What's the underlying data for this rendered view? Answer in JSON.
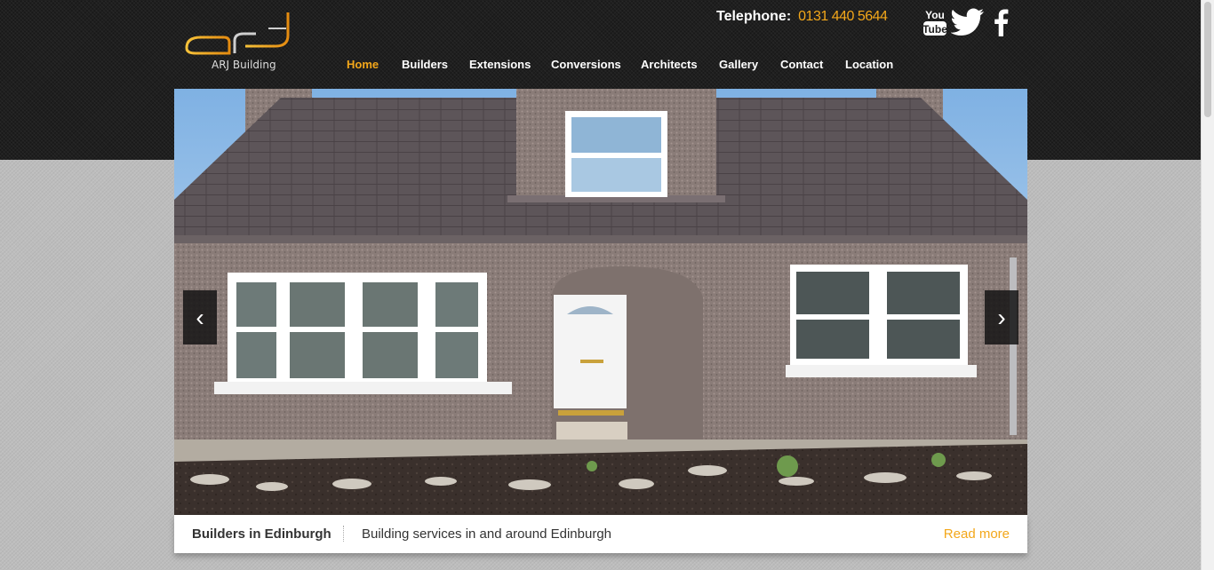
{
  "brand": {
    "name": "ARJ Building"
  },
  "header": {
    "telephone_label": "Telephone:",
    "telephone_number": "0131 440 5644"
  },
  "social": [
    {
      "icon": "youtube-icon",
      "label": "You Tube"
    },
    {
      "icon": "twitter-icon",
      "label": ""
    },
    {
      "icon": "facebook-icon",
      "label": "f"
    }
  ],
  "nav": {
    "items": [
      {
        "label": "Home",
        "active": true
      },
      {
        "label": "Builders"
      },
      {
        "label": "Extensions"
      },
      {
        "label": "Conversions"
      },
      {
        "label": "Architects"
      },
      {
        "label": "Gallery"
      },
      {
        "label": "Contact"
      },
      {
        "label": "Location"
      }
    ]
  },
  "slider": {
    "prev_label": "‹",
    "next_label": "›",
    "caption": {
      "title": "Builders in Edinburgh",
      "text": "Building services in and around Edinburgh",
      "link": "Read more"
    }
  },
  "colors": {
    "accent": "#f3a71a",
    "header_bg": "#1f1f1f",
    "page_bg": "#bdbdbd"
  }
}
